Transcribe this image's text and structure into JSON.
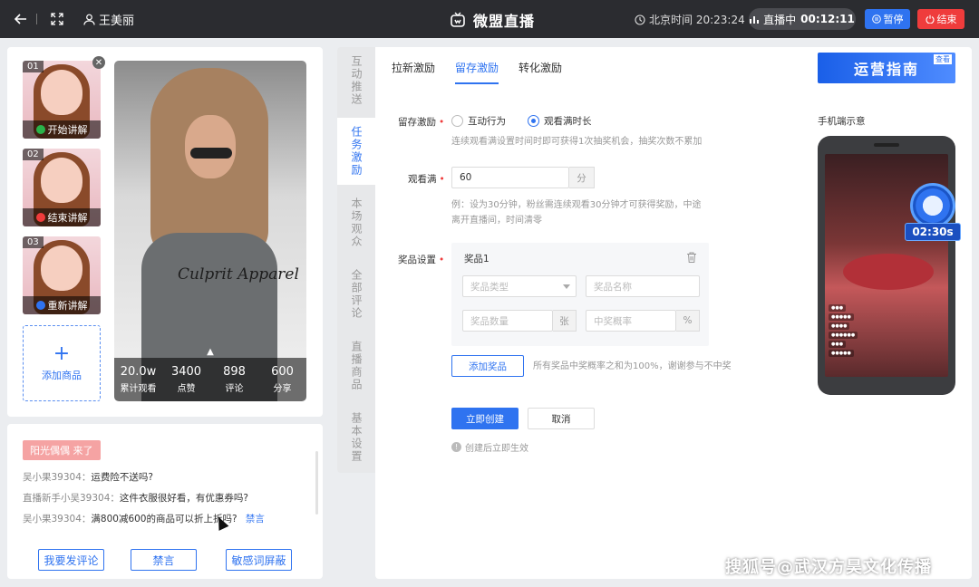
{
  "topbar": {
    "user": "王美丽",
    "title": "微盟直播",
    "clock": "北京时间 20:23:24",
    "live_label": "直播中",
    "live_time": "00:12:11",
    "pause": "暂停",
    "end": "结束"
  },
  "products": [
    {
      "index": "01",
      "action": "开始讲解",
      "dot_color": "#2ab34a"
    },
    {
      "index": "02",
      "action": "结束讲解",
      "dot_color": "#ef3c3c"
    },
    {
      "index": "03",
      "action": "重新讲解",
      "dot_color": "#2f73f0"
    }
  ],
  "add_product": "添加商品",
  "preview": {
    "shirt_text": "Culprit Apparel",
    "stats": [
      {
        "value": "20.0w",
        "label": "累计观看"
      },
      {
        "value": "3400",
        "label": "点赞"
      },
      {
        "value": "898",
        "label": "评论"
      },
      {
        "value": "600",
        "label": "分享"
      }
    ]
  },
  "comments": {
    "welcome": "阳光偶偶 来了",
    "items": [
      {
        "user": "吴小果39304：",
        "text": "运费险不送吗?"
      },
      {
        "user": "直播新手小吴39304：",
        "text": "这件衣服很好看，有优惠券吗?"
      },
      {
        "user": "吴小果39304：",
        "text": "满800减600的商品可以折上折吗?",
        "action": "禁言"
      }
    ],
    "buttons": [
      "我要发评论",
      "禁言",
      "敏感词屏蔽"
    ]
  },
  "side_tabs": [
    "互动推送",
    "任务激励",
    "本场观众",
    "全部评论",
    "直播商品",
    "基本设置"
  ],
  "main": {
    "tabs": [
      "拉新激励",
      "留存激励",
      "转化激励"
    ],
    "guide": "运营指南",
    "guide_tag": "查看",
    "retention_label": "留存激励",
    "radio_options": [
      "互动行为",
      "观看满时长"
    ],
    "retention_hint": "连续观看满设置时间时即可获得1次抽奖机会，抽奖次数不累加",
    "watch_label": "观看满",
    "watch_value": "60",
    "watch_unit": "分",
    "watch_hint_1": "例：设为30分钟，粉丝需连续观看30分钟才可获得奖励，中途",
    "watch_hint_2": "离开直播间，时间清零",
    "prize_label": "奖品设置",
    "prize_title": "奖品1",
    "prize_type_ph": "奖品类型",
    "prize_name_ph": "奖品名称",
    "prize_qty_ph": "奖品数量",
    "prize_qty_unit": "张",
    "prize_prob_ph": "中奖概率",
    "prize_prob_unit": "%",
    "add_prize": "添加奖品",
    "add_prize_hint": "所有奖品中奖概率之和为100%，谢谢参与不中奖",
    "create": "立即创建",
    "cancel": "取消",
    "note": "创建后立即生效",
    "phone_label": "手机端示意",
    "timer": "02:30s"
  },
  "watermark": "搜狐号@武汉方昊文化传播",
  "colors": {
    "accent": "#2f73f0",
    "danger": "#ef3c3c",
    "topbar": "#2b2c30"
  }
}
